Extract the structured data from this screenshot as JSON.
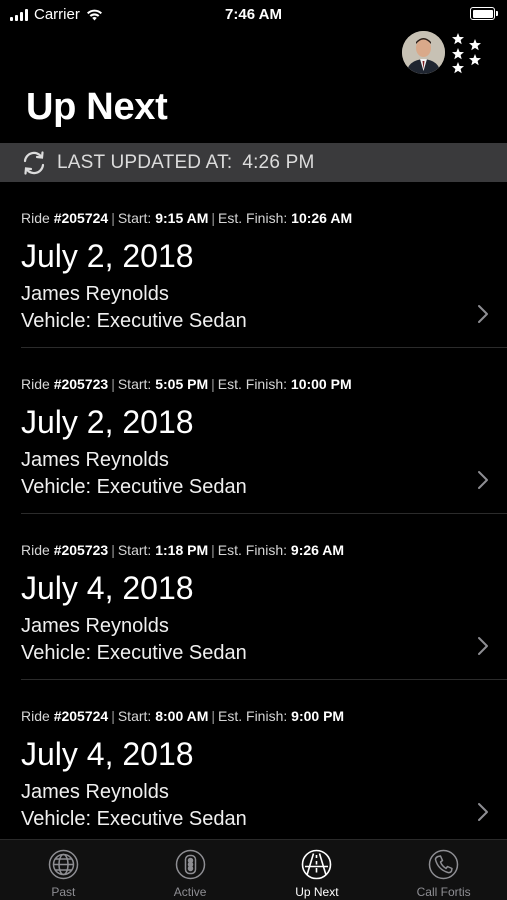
{
  "status_bar": {
    "carrier": "Carrier",
    "time": "7:46 AM"
  },
  "header": {
    "title": "Up Next"
  },
  "last_updated": {
    "label": "LAST UPDATED AT:",
    "time": "4:26 PM"
  },
  "ride_labels": {
    "ride": "Ride",
    "start": "Start:",
    "est_finish": "Est. Finish:",
    "vehicle_prefix": "Vehicle:"
  },
  "rides": [
    {
      "ride_no": "#205724",
      "start": "9:15 AM",
      "finish": "10:26 AM",
      "date": "July 2, 2018",
      "driver": "James Reynolds",
      "vehicle": "Vehicle: Executive Sedan"
    },
    {
      "ride_no": "#205723",
      "start": "5:05 PM",
      "finish": "10:00 PM",
      "date": "July 2, 2018",
      "driver": "James Reynolds",
      "vehicle": "Vehicle: Executive Sedan"
    },
    {
      "ride_no": "#205723",
      "start": "1:18 PM",
      "finish": "9:26 AM",
      "date": "July 4, 2018",
      "driver": "James Reynolds",
      "vehicle": "Vehicle: Executive Sedan"
    },
    {
      "ride_no": "#205724",
      "start": "8:00 AM",
      "finish": "9:00 PM",
      "date": "July 4, 2018",
      "driver": "James Reynolds",
      "vehicle": "Vehicle: Executive Sedan"
    }
  ],
  "tabs": [
    {
      "label": "Past",
      "icon": "globe-icon",
      "active": false
    },
    {
      "label": "Active",
      "icon": "traffic-light-icon",
      "active": false
    },
    {
      "label": "Up Next",
      "icon": "road-icon",
      "active": true
    },
    {
      "label": "Call Fortis",
      "icon": "phone-icon",
      "active": false
    }
  ],
  "colors": {
    "background": "#000000",
    "updated_bar": "#3a3a3c",
    "tab_inactive": "#8e8e93",
    "tab_active": "#ffffff"
  }
}
